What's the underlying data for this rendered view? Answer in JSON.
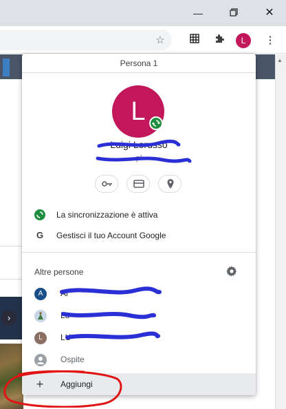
{
  "window": {
    "minimize_icon": "minimize-icon",
    "restore_icon": "restore-icon",
    "close_icon": "close-icon"
  },
  "toolbar": {
    "icons": [
      "star-icon",
      "grid-extension-icon",
      "puzzle-extensions-icon",
      "profile-avatar",
      "more-vert-icon"
    ],
    "avatar_letter": "L",
    "avatar_color": "#c2185b"
  },
  "profile_menu": {
    "header": "Persona 1",
    "avatar_letter": "L",
    "avatar_color": "#c2185b",
    "sync_badge_color": "#1e8e3e",
    "name": "Luigi Lorusso",
    "email": "pl",
    "quick_actions": [
      "key-icon",
      "card-icon",
      "location-icon"
    ],
    "sync_status": "La sincronizzazione è attiva",
    "manage_account": "Gestisci il tuo Account Google",
    "manage_account_glyph": "G",
    "other_people_label": "Altre persone",
    "other_people": [
      {
        "letter": "A",
        "name": "Al",
        "color": "#1a4f8a"
      },
      {
        "letter": "",
        "name": "Lu",
        "color": "#b8c8d8"
      },
      {
        "letter": "L",
        "name": "LU",
        "color": "#8d6e63"
      }
    ],
    "guest": "Ospite",
    "add": "Aggiungi",
    "add_glyph": "+"
  },
  "background": {
    "chevron": "›"
  }
}
